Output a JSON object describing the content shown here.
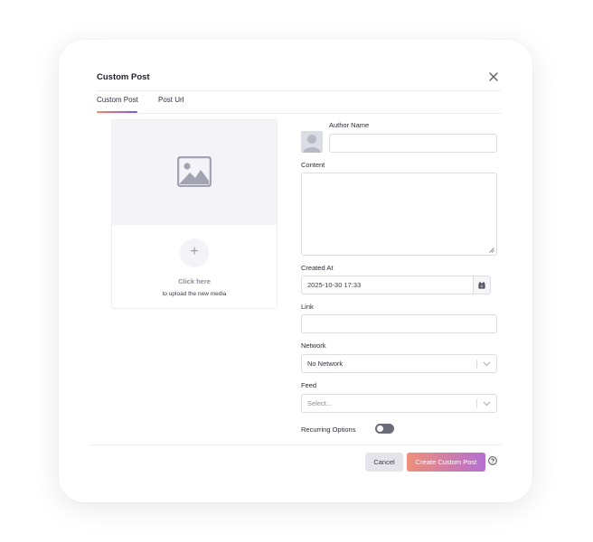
{
  "modal": {
    "title": "Custom Post"
  },
  "tabs": [
    {
      "label": "Custom Post",
      "active": true
    },
    {
      "label": "Post Url",
      "active": false
    }
  ],
  "media": {
    "click_here": "Click here",
    "upload_text": "to upload the new media",
    "plus_symbol": "+"
  },
  "form": {
    "author_name_label": "Author Name",
    "author_name_value": "",
    "content_label": "Content",
    "content_value": "",
    "created_at_label": "Created At",
    "created_at_value": "2025-10-30 17:33",
    "link_label": "Link",
    "link_value": "",
    "network_label": "Network",
    "network_value": "No Network",
    "feed_label": "Feed",
    "feed_placeholder": "Select...",
    "recurring_label": "Recurring Options",
    "recurring_enabled": false
  },
  "footer": {
    "cancel_label": "Cancel",
    "create_label": "Create Custom Post"
  },
  "colors": {
    "accent_start": "#ee8f7a",
    "accent_end": "#b46fd0",
    "tab_underline_start": "#f08a6a",
    "tab_underline_end": "#7a5ae0"
  },
  "icons": [
    "close-icon",
    "image-placeholder-icon",
    "plus-icon",
    "user-avatar-icon",
    "calendar-icon",
    "chevron-down-icon",
    "help-icon",
    "resize-handle-icon"
  ]
}
